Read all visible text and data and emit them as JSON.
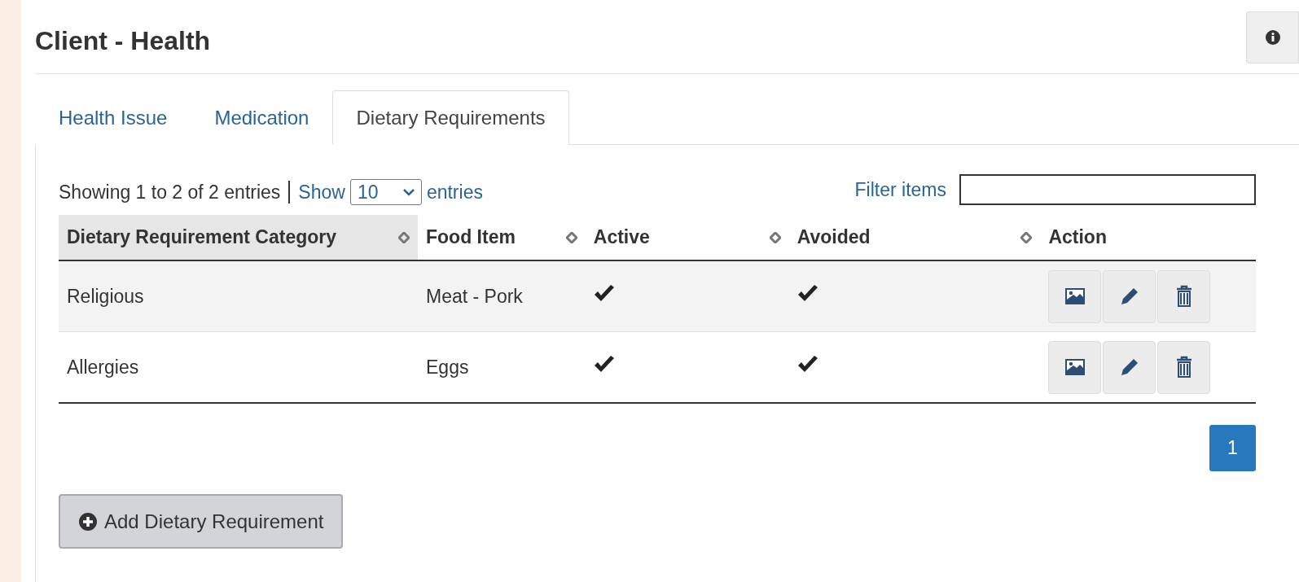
{
  "header": {
    "title": "Client - Health"
  },
  "tabs": [
    {
      "label": "Health Issue",
      "selected": false
    },
    {
      "label": "Medication",
      "selected": false
    },
    {
      "label": "Dietary Requirements",
      "selected": true
    }
  ],
  "table_info": {
    "summary": "Showing 1 to 2 of 2 entries",
    "show_label": "Show",
    "page_size": "10",
    "entries_label": "entries"
  },
  "filter": {
    "label": "Filter items"
  },
  "table": {
    "columns": [
      {
        "label": "Dietary Requirement Category",
        "sorted": true
      },
      {
        "label": "Food Item",
        "sorted": false
      },
      {
        "label": "Active",
        "sorted": false
      },
      {
        "label": "Avoided",
        "sorted": false
      },
      {
        "label": "Action",
        "sorted": false
      }
    ],
    "rows": [
      {
        "category": "Religious",
        "food_item": "Meat - Pork",
        "active": true,
        "avoided": true
      },
      {
        "category": "Allergies",
        "food_item": "Eggs",
        "active": true,
        "avoided": true
      }
    ]
  },
  "pagination": [
    {
      "label": "1",
      "selected": true
    }
  ],
  "add_button": {
    "label": "Add Dietary Requirement"
  }
}
